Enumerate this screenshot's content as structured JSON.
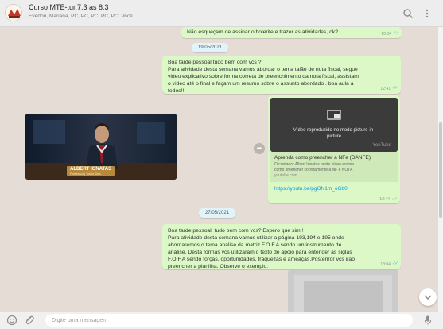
{
  "header": {
    "title": "Curso MTE-tur.7:3 as 8:3",
    "members": "Everton, Mariana, PC, PC, PC, PC, PC, Você",
    "icons": [
      "search-icon",
      "menu-icon"
    ]
  },
  "messages": {
    "m1": {
      "text": "Não esqueçam de assinar o holerite e trazer as atividades, ok?",
      "time": "10:04"
    },
    "date1": "19/05/2021",
    "m2": {
      "line1": "Boa tarde pessoal tudo bem com vcs ?",
      "line2": "Para atividade desta semana vamos abordar o tema talão de nota fiscal, segue",
      "line3": "video explicativo sobre forma correta de preenchimento da nota fiscal, assistam",
      "line4": "o video até o final e façam um resumo sobre o assunto abordado . boa aula a",
      "line5": "todos!!!",
      "time": "12:41"
    },
    "video": {
      "presenter_name": "ALBERT IONATAS",
      "presenter_subtitle": "Professor | Sócio Dec"
    },
    "link_message": {
      "pip_line1": "Vídeo reproduzido no modo picture-in-",
      "pip_line2": "picture",
      "yt_brand": "YouTube",
      "title": "Aprenda como preencher a NFe (DANFE)",
      "desc1": "O contador Albert Ionatas neste vídeo ensina",
      "desc2": "como preencher corretamente a NF e NOTA",
      "domain": "youtube.com",
      "href": "https://youtu.be/pgON1m_oGb0",
      "time": "12:44"
    },
    "date2": "27/05/2021",
    "m3": {
      "line1": "Boa tarde pessoal, tudo bem com vcs? Espero que sim !",
      "line2": "Para atividade desta semana vamos utilizar a página 193,194 e 195 onde",
      "line3": "abordaremos o tema  análise da matriz F.O.F.A sendo um instrumento de",
      "line4": "análise. Desta formas vcs utilizaram o texto de apoio para entender as siglas",
      "line5": "F.O.F.A sendo forças, oportunidades, fraquezas e ameaças.Posteriror vcs irão",
      "line6": "preencher a planilha.  Observe o exemplo:",
      "time": "13:04"
    }
  },
  "footer": {
    "placeholder": "Digite uma mensagem",
    "icons": [
      "emoji-icon",
      "attach-icon",
      "microphone-icon"
    ]
  },
  "colors": {
    "outgoing_bubble": "#dcf8c6",
    "chat_background": "#e5ddd5",
    "date_chip": "#e1f3fb",
    "link": "#039be5",
    "read_ticks": "#4fc3f7"
  }
}
